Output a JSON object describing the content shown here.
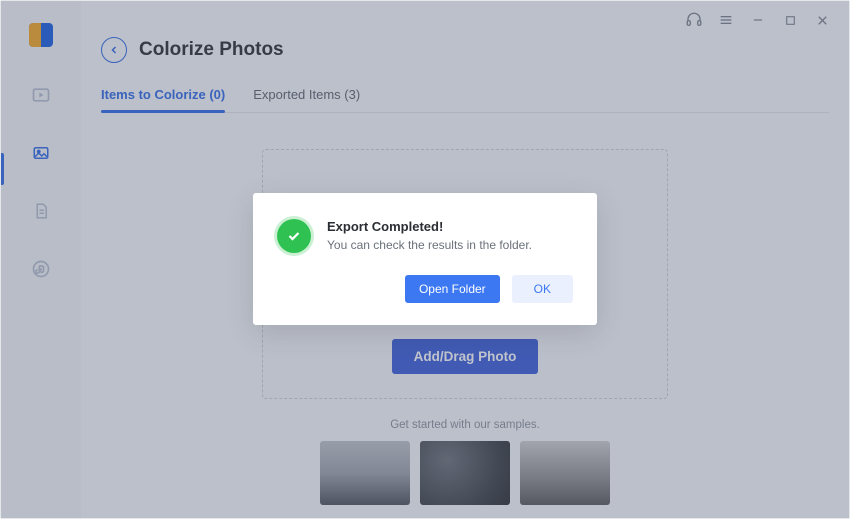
{
  "header": {
    "page_title": "Colorize Photos"
  },
  "tabs": [
    {
      "label": "Items to Colorize (0)"
    },
    {
      "label": "Exported Items (3)"
    }
  ],
  "dropzone": {
    "add_button": "Add/Drag Photo"
  },
  "samples": {
    "label": "Get started with our samples."
  },
  "modal": {
    "title": "Export Completed!",
    "message": "You can check the results in the folder.",
    "open_folder": "Open Folder",
    "ok": "OK"
  }
}
